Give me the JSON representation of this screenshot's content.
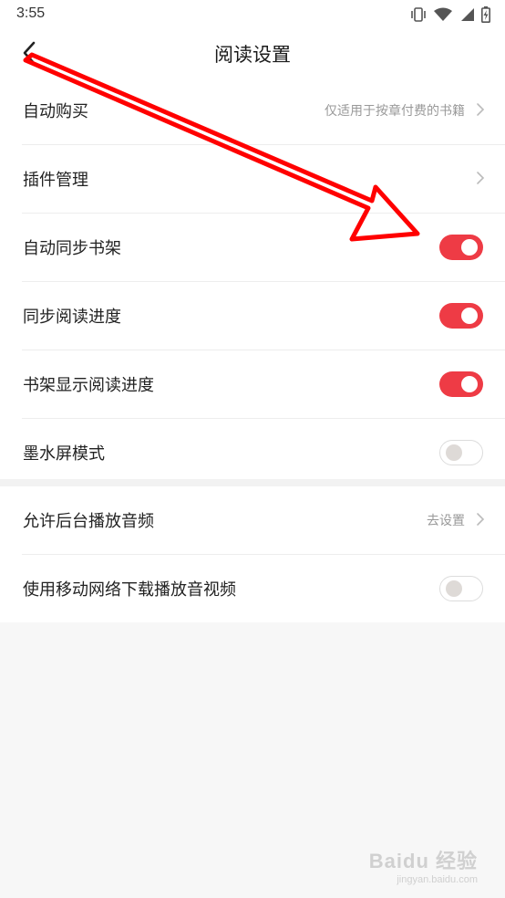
{
  "status_bar": {
    "time": "3:55",
    "icons": [
      "vibrate-icon",
      "wifi-icon",
      "signal-icon",
      "battery-charging-icon"
    ]
  },
  "header": {
    "title": "阅读设置",
    "back_icon": "chevron-left-icon"
  },
  "sections": [
    {
      "rows": [
        {
          "label": "自动购买",
          "value": "仅适用于按章付费的书籍",
          "type": "link"
        },
        {
          "label": "插件管理",
          "value": "",
          "type": "link"
        },
        {
          "label": "自动同步书架",
          "type": "toggle",
          "on": true
        },
        {
          "label": "同步阅读进度",
          "type": "toggle",
          "on": true
        },
        {
          "label": "书架显示阅读进度",
          "type": "toggle",
          "on": true
        },
        {
          "label": "墨水屏模式",
          "type": "toggle",
          "on": false
        }
      ]
    },
    {
      "rows": [
        {
          "label": "允许后台播放音频",
          "value": "去设置",
          "type": "link"
        },
        {
          "label": "使用移动网络下载播放音视频",
          "type": "toggle",
          "on": false
        }
      ]
    }
  ],
  "colors": {
    "accent": "#ee3b45",
    "annotation_arrow": "#ff0000",
    "background": "#f7f7f7"
  },
  "watermark": {
    "logo": "Baidu 经验",
    "url": "jingyan.baidu.com"
  }
}
